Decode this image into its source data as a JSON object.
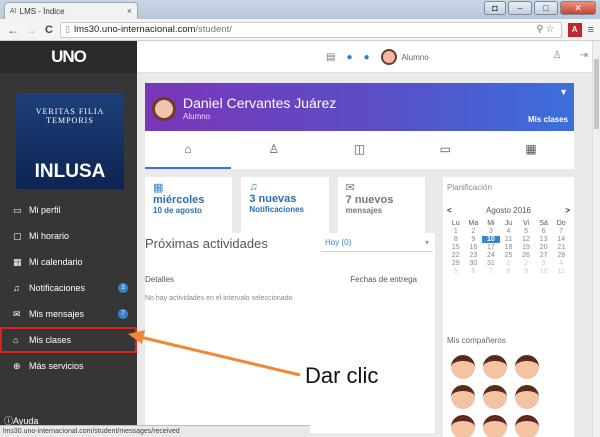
{
  "browser": {
    "tab_title": "LMS - Índice",
    "tab_favicon": "A!",
    "url_host": "lms30.uno-internacional.com",
    "url_path": "/student/",
    "status_url": "lms30.uno-internacional.com/student/messages/received"
  },
  "header": {
    "logo": "UNO",
    "user_label": "Alumno"
  },
  "sidebar": {
    "brand": "INLUSA",
    "seal_text": "VERITAS FILIA TEMPORIS",
    "items": [
      {
        "label": "Mi perfil",
        "icon": "id-card-icon"
      },
      {
        "label": "Mi horario",
        "icon": "monitor-icon"
      },
      {
        "label": "Mi calendario",
        "icon": "calendar-icon"
      },
      {
        "label": "Notificaciones",
        "icon": "bell-icon",
        "badge": "3"
      },
      {
        "label": "Mis mensajes",
        "icon": "envelope-icon",
        "badge": "7"
      },
      {
        "label": "Mis clases",
        "icon": "chalkboard-icon"
      },
      {
        "label": "Más servicios",
        "icon": "plus-circle-icon"
      }
    ],
    "help": "Ayuda"
  },
  "profile": {
    "name": "Daniel Cervantes Juárez",
    "role": "Alumno",
    "clases_link": "Mis clases"
  },
  "widgets": {
    "date_day": "miércoles",
    "date_full": "10 de agosto",
    "notif_count": "3 nuevas",
    "notif_label": "Notificaciones",
    "msg_count": "7 nuevos",
    "msg_label": "mensajes"
  },
  "activities": {
    "title": "Próximas actividades",
    "filter": "Hoy (0)",
    "col_details": "Detalles",
    "col_due": "Fechas de entrega",
    "empty": "No hay actividades en el intervalo seleccionado"
  },
  "calendar": {
    "title": "Planificación",
    "month": "Agosto 2016",
    "prev": "<",
    "next": ">",
    "weekdays": [
      "Lu",
      "Ma",
      "Mi",
      "Ju",
      "Vi",
      "Sá",
      "Do"
    ],
    "days": [
      "1",
      "2",
      "3",
      "4",
      "5",
      "6",
      "7",
      "8",
      "9",
      "10",
      "11",
      "12",
      "13",
      "14",
      "15",
      "16",
      "17",
      "18",
      "19",
      "20",
      "21",
      "22",
      "23",
      "24",
      "25",
      "26",
      "27",
      "28",
      "29",
      "30",
      "31",
      "1",
      "2",
      "3",
      "4",
      "5",
      "6",
      "7",
      "8",
      "9",
      "10",
      "11"
    ],
    "today": "10"
  },
  "mates_title": "Mis compañeros",
  "annotation": "Dar clic",
  "colors": {
    "sidebar_bg": "#363636",
    "accent_blue": "#3a84cc",
    "banner_start": "#7a35b8",
    "banner_end": "#3b6fdc",
    "highlight_red": "#d9251d",
    "arrow_orange": "#f0883a"
  }
}
